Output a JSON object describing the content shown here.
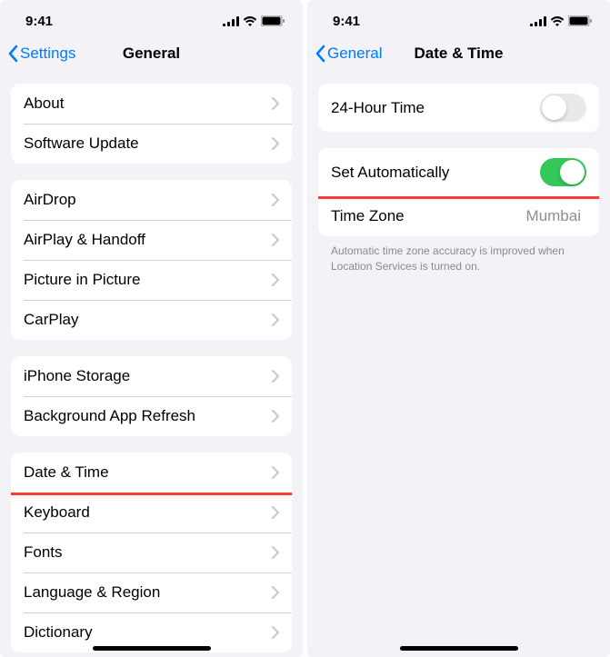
{
  "status": {
    "time": "9:41"
  },
  "left": {
    "back": "Settings",
    "title": "General",
    "g1": [
      {
        "label": "About"
      },
      {
        "label": "Software Update"
      }
    ],
    "g2": [
      {
        "label": "AirDrop"
      },
      {
        "label": "AirPlay & Handoff"
      },
      {
        "label": "Picture in Picture"
      },
      {
        "label": "CarPlay"
      }
    ],
    "g3": [
      {
        "label": "iPhone Storage"
      },
      {
        "label": "Background App Refresh"
      }
    ],
    "g4": [
      {
        "label": "Date & Time"
      },
      {
        "label": "Keyboard"
      },
      {
        "label": "Fonts"
      },
      {
        "label": "Language & Region"
      },
      {
        "label": "Dictionary"
      }
    ]
  },
  "right": {
    "back": "General",
    "title": "Date & Time",
    "r1": {
      "label": "24-Hour Time"
    },
    "r2": {
      "label": "Set Automatically"
    },
    "r3": {
      "label": "Time Zone",
      "value": "Mumbai"
    },
    "footer": "Automatic time zone accuracy is improved when Location Services is turned on."
  }
}
